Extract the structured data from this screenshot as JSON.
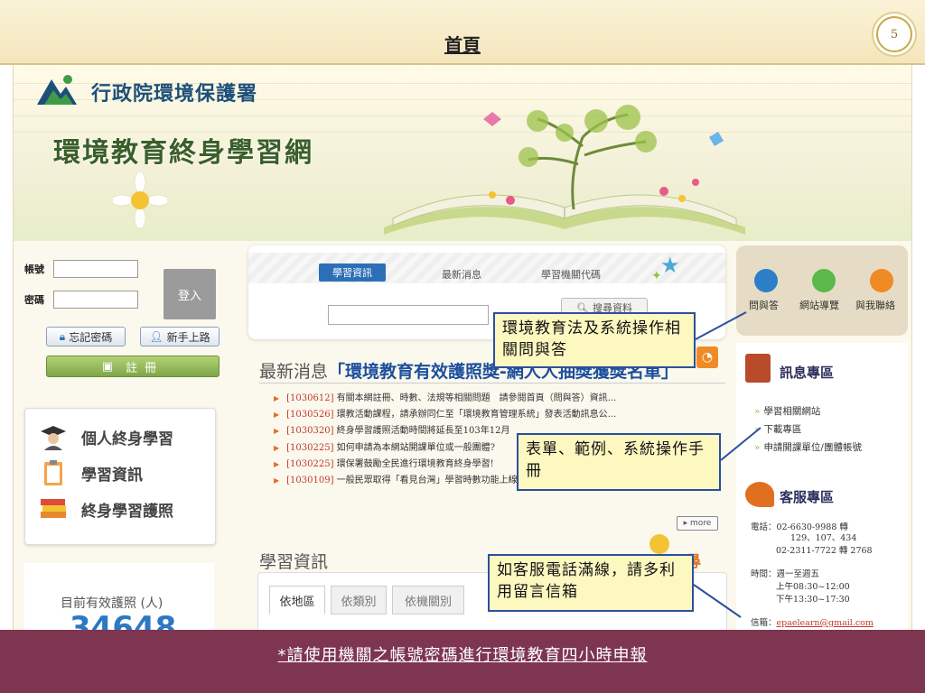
{
  "slide": {
    "title": "首頁",
    "page_number": "5",
    "footer_note": "*請使用機關之帳號密碼進行環境教育四小時申報"
  },
  "site": {
    "agency_name": "行政院環境保護署",
    "site_title": "環境教育終身學習網"
  },
  "login": {
    "account_label": "帳號",
    "password_label": "密碼",
    "login_button": "登入",
    "forgot_password": "忘記密碼",
    "beginner_guide": "新手上路",
    "register": "註冊"
  },
  "left_menu": {
    "items": [
      {
        "label": "個人終身學習",
        "icon": "graduate-icon"
      },
      {
        "label": "學習資訊",
        "icon": "clipboard-icon"
      },
      {
        "label": "終身學習護照",
        "icon": "books-icon"
      }
    ]
  },
  "license": {
    "label": "目前有效護照 (人)",
    "count": "34648"
  },
  "search": {
    "tabs": [
      "學習資訊",
      "最新消息",
      "學習機關代碼"
    ],
    "search_button": "搜尋資料"
  },
  "news": {
    "heading_prefix": "最新消息",
    "heading_highlight": "「環境教育有效護照獎-",
    "heading_suffix": "網人人抽獎獲獎名單」",
    "items": [
      {
        "date": "[1030612]",
        "text": " 有關本網註冊、時數、法規等相關問題　請參閱首頁（問與答）資訊..."
      },
      {
        "date": "[1030526]",
        "text": " 環教活動課程，請承辦同仁至「環境教育管理系統」發表活動訊息公..."
      },
      {
        "date": "[1030320]",
        "text": " 終身學習護照活動時間將延長至103年12月"
      },
      {
        "date": "[1030225]",
        "text": " 如何申請為本網站開課單位或一般團體?"
      },
      {
        "date": "[1030225]",
        "text": " 環保署鼓勵全民進行環境教育終身學習!"
      },
      {
        "date": "[1030109]",
        "text": " 一般民眾取得「看見台灣」學習時數功能上線"
      }
    ],
    "more": "▸ more"
  },
  "learning": {
    "heading": "學習資訊",
    "tabs": [
      "依地區",
      "依類別",
      "依機關別"
    ],
    "truncated_right": "尋"
  },
  "quick_links": {
    "items": [
      {
        "label": "問與答",
        "icon": "question-icon"
      },
      {
        "label": "網站導覽",
        "icon": "home-icon"
      },
      {
        "label": "與我聯絡",
        "icon": "mail-icon"
      }
    ]
  },
  "info": {
    "title": "訊息專區",
    "links": [
      "學習相關網站",
      "下載專區",
      "申請開課單位/團體帳號"
    ]
  },
  "service": {
    "title": "客服專區",
    "phone_label": "電話：02-6630-9988 轉",
    "phone_ext": "129、107、434",
    "phone_alt": "02-2311-7722 轉 2768",
    "hours_label": "時間：週一至週五",
    "hours_am": "上午08:30~12:00",
    "hours_pm": "下午13:30~17:30",
    "email_label": "信箱：",
    "email": "epaelearn@gmail.com"
  },
  "callouts": {
    "faq": "環境教育法及系統操作相關問與答",
    "download": "表單、範例、系統操作手冊",
    "service": "如客服電話滿線，請多利用留言信箱"
  },
  "colors": {
    "header_bg": "#f4e6bc",
    "footer_bg": "#7d3550",
    "callout_bg": "#fdf7c0",
    "callout_border": "#2a50a0",
    "tab_active": "#2c6fb7"
  }
}
